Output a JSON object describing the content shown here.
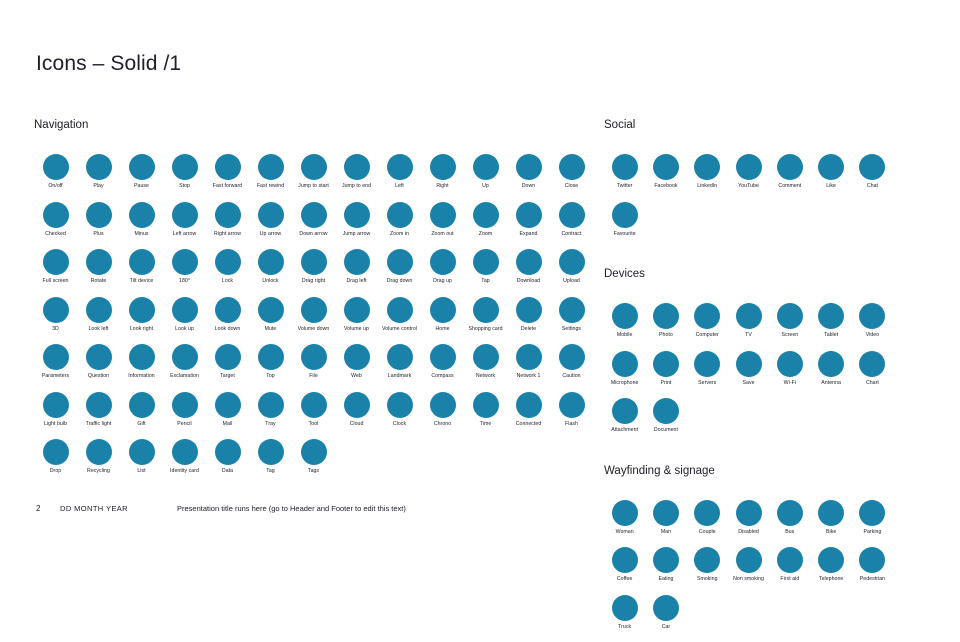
{
  "slide": {
    "title": "Icons – Solid /1"
  },
  "sections": {
    "navigation": {
      "heading": "Navigation",
      "icons": [
        "On/off",
        "Play",
        "Pause",
        "Stop",
        "Fast forward",
        "Fast rewind",
        "Jump to start",
        "Jump to end",
        "Left",
        "Right",
        "Up",
        "Down",
        "Close",
        "Checked",
        "Plus",
        "Minus",
        "Left arrow",
        "Right arrow",
        "Up arrow",
        "Down arrow",
        "Jump arrow",
        "Zoom in",
        "Zoom out",
        "Zoom",
        "Expand",
        "Contract",
        "Full screen",
        "Rotate",
        "Tilt device",
        "180°",
        "Lock",
        "Unlock",
        "Drag right",
        "Drag left",
        "Drag down",
        "Drag up",
        "Tap",
        "Download",
        "Upload",
        "3D",
        "Look left",
        "Look right",
        "Look up",
        "Look down",
        "Mute",
        "Volume down",
        "Volume up",
        "Volume control",
        "Home",
        "Shopping card",
        "Delete",
        "Settings",
        "Parameters",
        "Question",
        "Information",
        "Exclamation",
        "Target",
        "Top",
        "File",
        "Web",
        "Landmark",
        "Compass",
        "Network",
        "Network 1",
        "Caution",
        "Light bulb",
        "Traffic light",
        "Gift",
        "Pencil",
        "Mail",
        "Tray",
        "Tool",
        "Cloud",
        "Clock",
        "Chrono",
        "Time",
        "Connected",
        "Flash",
        "Drop",
        "Recycling",
        "List",
        "Identity card",
        "Data",
        "Tag",
        "Tags"
      ]
    },
    "social": {
      "heading": "Social",
      "icons": [
        "Twitter",
        "Facebook",
        "LinkedIn",
        "YouTube",
        "Comment",
        "Like",
        "Chat",
        "Favourite"
      ]
    },
    "devices": {
      "heading": "Devices",
      "icons": [
        "Mobile",
        "Photo",
        "Computer",
        "TV",
        "Screen",
        "Tablet",
        "Video",
        "Microphone",
        "Print",
        "Servers",
        "Save",
        "Wi-Fi",
        "Antenna",
        "Chart",
        "Attachment",
        "Document"
      ]
    },
    "wayfinding": {
      "heading": "Wayfinding & signage",
      "icons": [
        "Woman",
        "Man",
        "Couple",
        "Disabled",
        "Bus",
        "Bike",
        "Parking",
        "Coffee",
        "Eating",
        "Smoking",
        "Non smoking",
        "First aid",
        "Telephone",
        "Pedestrian",
        "Truck",
        "Car"
      ]
    }
  },
  "footer": {
    "page_number": "2",
    "date": "DD MONTH YEAR",
    "note": "Presentation title runs here (go to Header and Footer to edit this text)"
  },
  "colors": {
    "icon_fill": "#1a82a8",
    "text": "#20202c",
    "background": "#ffffff"
  }
}
